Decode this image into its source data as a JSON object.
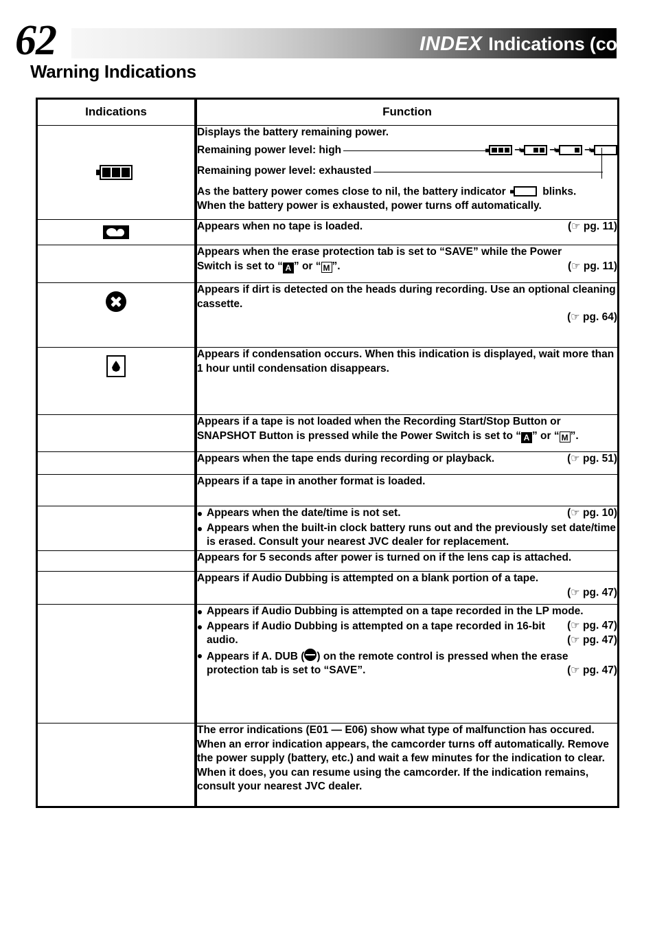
{
  "header": {
    "page_number": "62",
    "index_label": "INDEX",
    "subtitle": "Indications (cont.)"
  },
  "section_title": "Warning Indications",
  "table": {
    "columns": [
      "Indications",
      "Function"
    ],
    "rows": [
      {
        "icon": "battery-full-icon",
        "lines": {
          "l1": "Displays the battery remaining power.",
          "l2": "Remaining power level: high",
          "l3": "Remaining power level: exhausted",
          "l4a": "As the battery power comes close to nil, the battery indicator",
          "l4b": "blinks.",
          "l5": "When the battery power is exhausted, power turns off automatically."
        },
        "battery_sequence": [
          3,
          2,
          1,
          0
        ]
      },
      {
        "icon": "cassette-no-tape-icon",
        "text": "Appears when no tape is loaded.",
        "pgref": "pg. 11"
      },
      {
        "icon": "none",
        "text_a": "Appears when the erase protection tab is set to “SAVE” while the Power",
        "text_b1": "Switch is set to “",
        "glyph_a": "A",
        "text_b2": "” or “",
        "glyph_m": "M",
        "text_b3": "”.",
        "pgref": "pg. 11"
      },
      {
        "icon": "dirty-head-x-icon",
        "text": "Appears if dirt is detected on the heads during recording. Use an optional cleaning cassette.",
        "pgref": "pg. 64"
      },
      {
        "icon": "condensation-dew-icon",
        "text": "Appears if condensation occurs. When this indication is displayed, wait more than 1 hour until condensation disappears."
      },
      {
        "icon": "none",
        "text_a": "Appears if a tape is not loaded when the Recording Start/Stop Button or",
        "text_b1": "SNAPSHOT Button is pressed while the Power Switch is set to “",
        "glyph_a": "A",
        "text_b2": "” or “",
        "glyph_m": "M",
        "text_b3": "”."
      },
      {
        "icon": "none",
        "text": "Appears when the tape ends during recording or playback.",
        "pgref": "pg. 51"
      },
      {
        "icon": "none",
        "text": "Appears if a tape in another format is loaded."
      },
      {
        "icon": "none",
        "bullets": [
          {
            "text": "Appears when the date/time is not set.",
            "pgref": "pg. 10"
          },
          {
            "text": "Appears when the built-in clock battery runs out and the previously set date/time is erased. Consult your nearest JVC dealer for replacement."
          }
        ]
      },
      {
        "icon": "none",
        "text": "Appears for 5 seconds after power is turned on if the lens cap is attached."
      },
      {
        "icon": "none",
        "text": "Appears if Audio Dubbing is attempted on a blank portion of a tape.",
        "pgref_below": "pg. 47"
      },
      {
        "icon": "none",
        "bullets_dub": [
          {
            "text": "Appears if Audio Dubbing is attempted on a tape recorded in the LP mode.",
            "pgref": "pg. 47"
          },
          {
            "text": "Appears if Audio Dubbing is attempted on a tape recorded in 16-bit audio.",
            "pgref": "pg. 47"
          },
          {
            "pre": "Appears if A. DUB (",
            "glyph": "adub-icon",
            "post": ") on the remote control is pressed when the erase protection tab is set to “SAVE”.",
            "pgref": "pg. 47"
          }
        ]
      },
      {
        "icon": "none",
        "text": "The error indications (E01 — E06) show what type of malfunction has occured. When an error indication appears, the camcorder turns off automatically. Remove the power supply (battery, etc.) and wait a few minutes for the indication to clear. When it does, you can resume using the camcorder. If the indication remains, consult your nearest JVC dealer."
      }
    ]
  },
  "symbols": {
    "hand": "☞",
    "arrow": "→",
    "paren_open": "(",
    "paren_close": ")"
  }
}
